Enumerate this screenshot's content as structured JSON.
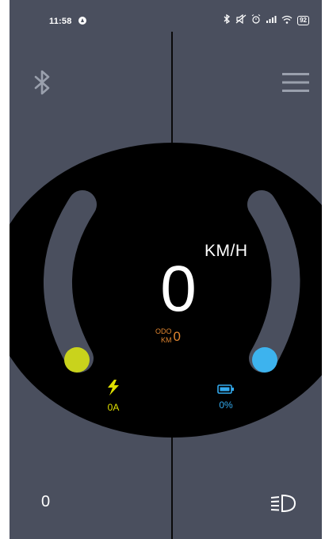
{
  "status_bar": {
    "time": "11:58",
    "battery_level": "92"
  },
  "speedometer": {
    "speed": "0",
    "unit": "KM/H",
    "odo_label_top": "ODO",
    "odo_label_bottom": "KM",
    "odo_value": "0"
  },
  "current": {
    "value": "0A"
  },
  "battery": {
    "value": "0%"
  },
  "bottom": {
    "trip_value": "0"
  },
  "icons": {
    "top_left": "bluetooth-icon",
    "top_right": "menu-icon",
    "bottom_right": "headlight-icon",
    "current": "lightning-icon",
    "battery": "battery-icon"
  },
  "colors": {
    "background": "#4a4f5e",
    "dial": "#000000",
    "arc": "#4a4f5e",
    "left_knob": "#c9d31c",
    "right_knob": "#3db3ee",
    "odo": "#e0852f",
    "current": "#e0e000",
    "battery": "#33aaee"
  }
}
